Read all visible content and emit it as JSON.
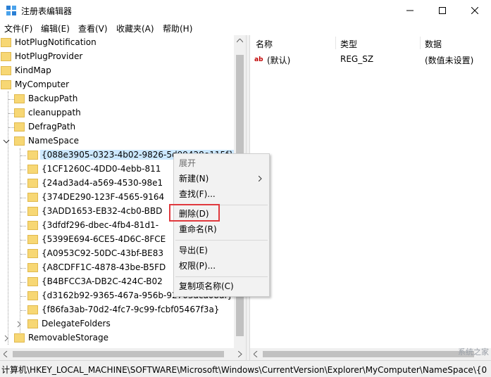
{
  "window": {
    "title": "注册表编辑器"
  },
  "menu": [
    "文件(F)",
    "编辑(E)",
    "查看(V)",
    "收藏夹(A)",
    "帮助(H)"
  ],
  "tree": {
    "top_items": [
      "HotPlugNotification",
      "HotPlugProvider",
      "KindMap",
      "MyComputer"
    ],
    "mycomputer_children": [
      "BackupPath",
      "cleanuppath",
      "DefragPath",
      "NameSpace"
    ],
    "namespace_children": [
      "{088e3905-0323-4b02-9826-5d99428e115f}",
      "{1CF1260C-4DD0-4ebb-811",
      "{24ad3ad4-a569-4530-98e1",
      "{374DE290-123F-4565-9164",
      "{3ADD1653-EB32-4cb0-BBD",
      "{3dfdf296-dbec-4fb4-81d1-",
      "{5399E694-6CE5-4D6C-8FCE",
      "{A0953C92-50DC-43bf-BE83",
      "{A8CDFF1C-4878-43be-B5FD",
      "{B4BFCC3A-DB2C-424C-B02",
      "{d3162b92-9365-467a-956b-92703aca08af}",
      "{f86fa3ab-70d2-4fc7-9c99-fcbf05467f3a}"
    ],
    "after": [
      "DelegateFolders",
      "RemovableStorage"
    ]
  },
  "list": {
    "headers": [
      "名称",
      "类型",
      "数据"
    ],
    "row": {
      "name": "(默认)",
      "type": "REG_SZ",
      "data": "(数值未设置)",
      "icon": "ab"
    }
  },
  "context_menu": {
    "items": [
      "展开",
      "新建(N)",
      "查找(F)...",
      "删除(D)",
      "重命名(R)",
      "导出(E)",
      "权限(P)...",
      "复制项名称(C)"
    ]
  },
  "status": "计算机\\HKEY_LOCAL_MACHINE\\SOFTWARE\\Microsoft\\Windows\\CurrentVersion\\Explorer\\MyComputer\\NameSpace\\{0",
  "watermark": "系统之家",
  "colors": {
    "folder": "#f7d774",
    "highlight": "#e0393e",
    "selection": "#cce8ff"
  }
}
